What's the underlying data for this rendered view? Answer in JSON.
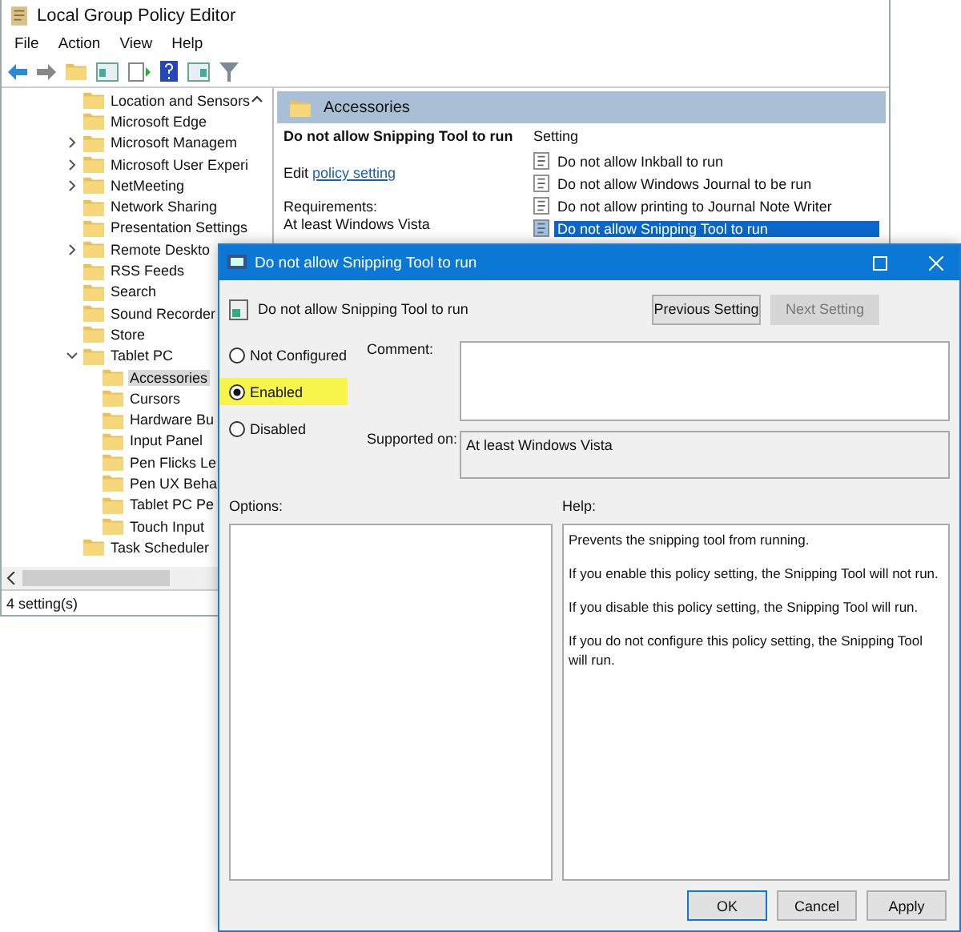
{
  "main_window": {
    "title": "Local Group Policy Editor",
    "menu": [
      "File",
      "Action",
      "View",
      "Help"
    ],
    "tree": [
      {
        "label": "Location and Sensors",
        "expandable": false,
        "selected": false
      },
      {
        "label": "Microsoft Edge",
        "expandable": false,
        "selected": false
      },
      {
        "label": "Microsoft Managem",
        "expandable": true,
        "expanded": false,
        "selected": false
      },
      {
        "label": "Microsoft User Experi",
        "expandable": true,
        "expanded": false,
        "selected": false
      },
      {
        "label": "NetMeeting",
        "expandable": true,
        "expanded": false,
        "selected": false
      },
      {
        "label": "Network Sharing",
        "expandable": false,
        "selected": false
      },
      {
        "label": "Presentation Settings",
        "expandable": false,
        "selected": false
      },
      {
        "label": "Remote Deskto",
        "expandable": true,
        "expanded": false,
        "selected": false
      },
      {
        "label": "RSS Feeds",
        "expandable": false,
        "selected": false
      },
      {
        "label": "Search",
        "expandable": false,
        "selected": false
      },
      {
        "label": "Sound Recorder",
        "expandable": false,
        "selected": false
      },
      {
        "label": "Store",
        "expandable": false,
        "selected": false
      },
      {
        "label": "Tablet PC",
        "expandable": true,
        "expanded": true,
        "selected": false,
        "children": [
          {
            "label": "Accessories",
            "expandable": false,
            "selected": true
          },
          {
            "label": "Cursors",
            "expandable": false,
            "selected": false
          },
          {
            "label": "Hardware Bu",
            "expandable": false,
            "selected": false
          },
          {
            "label": "Input Panel",
            "expandable": false,
            "selected": false
          },
          {
            "label": "Pen Flicks Le",
            "expandable": false,
            "selected": false
          },
          {
            "label": "Pen UX Beha",
            "expandable": false,
            "selected": false
          },
          {
            "label": "Tablet PC Pe",
            "expandable": false,
            "selected": false
          },
          {
            "label": "Touch Input",
            "expandable": false,
            "selected": false
          }
        ]
      },
      {
        "label": "Task Scheduler",
        "expandable": false,
        "selected": false
      }
    ],
    "pane": {
      "header": "Accessories",
      "policy_title": "Do not allow Snipping Tool to run",
      "edit_prefix": "Edit",
      "edit_link": "policy setting",
      "requirements_label": "Requirements:",
      "requirements_value": "At least Windows Vista",
      "column": "Setting",
      "settings": [
        {
          "label": "Do not allow Inkball to run",
          "selected": false
        },
        {
          "label": "Do not allow Windows Journal to be run",
          "selected": false
        },
        {
          "label": "Do not allow printing to Journal Note Writer",
          "selected": false
        },
        {
          "label": "Do not allow Snipping Tool to run",
          "selected": true
        }
      ]
    },
    "status_bar": "4 setting(s)"
  },
  "dialog": {
    "title": "Do not allow Snipping Tool to run",
    "subtitle": "Do not allow Snipping Tool to run",
    "nav_buttons": [
      {
        "label": "Previous Setting",
        "disabled": false
      },
      {
        "label": "Next Setting",
        "disabled": true
      }
    ],
    "options": [
      {
        "label": "Not Configured",
        "selected": false,
        "highlighted": false
      },
      {
        "label": "Enabled",
        "selected": true,
        "highlighted": true
      },
      {
        "label": "Disabled",
        "selected": false,
        "highlighted": false
      }
    ],
    "comment_label": "Comment:",
    "supported_label": "Supported on:",
    "supported_value": "At least Windows Vista",
    "options_label": "Options:",
    "help_label": "Help:",
    "help": [
      "Prevents the snipping tool from running.",
      "If you enable this policy setting, the Snipping Tool will not run.",
      "If you disable this policy setting, the Snipping Tool will run.",
      "If you do not configure this policy setting, the Snipping Tool will run."
    ],
    "buttons": [
      {
        "label": "OK",
        "default": true
      },
      {
        "label": "Cancel",
        "default": false
      },
      {
        "label": "Apply",
        "default": false
      }
    ]
  }
}
